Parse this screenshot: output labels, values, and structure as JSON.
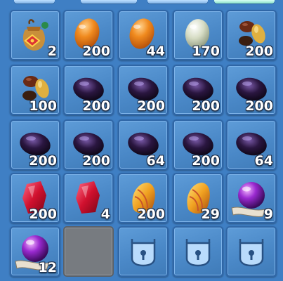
{
  "inventory": {
    "slots": [
      {
        "item": "coin-pouch-icon",
        "count": "2"
      },
      {
        "item": "orange-egg-icon",
        "count": "200"
      },
      {
        "item": "orange-egg-icon",
        "count": "44"
      },
      {
        "item": "pale-egg-icon",
        "count": "170"
      },
      {
        "item": "mixed-seeds-icon",
        "count": "200"
      },
      {
        "item": "mixed-seeds-icon",
        "count": "100"
      },
      {
        "item": "dark-gem-icon",
        "count": "200"
      },
      {
        "item": "dark-gem-icon",
        "count": "200"
      },
      {
        "item": "dark-gem-icon",
        "count": "200"
      },
      {
        "item": "dark-gem-icon",
        "count": "200"
      },
      {
        "item": "dark-gem-icon",
        "count": "200"
      },
      {
        "item": "dark-gem-icon",
        "count": "200"
      },
      {
        "item": "dark-gem-icon",
        "count": "64"
      },
      {
        "item": "dark-gem-icon",
        "count": "200"
      },
      {
        "item": "dark-gem-icon",
        "count": "64"
      },
      {
        "item": "red-gem-icon",
        "count": "200"
      },
      {
        "item": "red-gem-icon",
        "count": "4"
      },
      {
        "item": "amber-shell-icon",
        "count": "200"
      },
      {
        "item": "amber-shell-icon",
        "count": "29"
      },
      {
        "item": "purple-orb-scroll-icon",
        "count": "9"
      },
      {
        "item": "purple-orb-scroll-icon",
        "count": "12"
      },
      {
        "item": "empty-slot",
        "count": ""
      },
      {
        "item": "padlock-icon",
        "count": ""
      },
      {
        "item": "padlock-icon",
        "count": ""
      },
      {
        "item": "padlock-icon",
        "count": ""
      }
    ]
  },
  "colors": {
    "background": "#3f7fc4",
    "slot": "#4a88c7",
    "empty": "#777b80"
  }
}
